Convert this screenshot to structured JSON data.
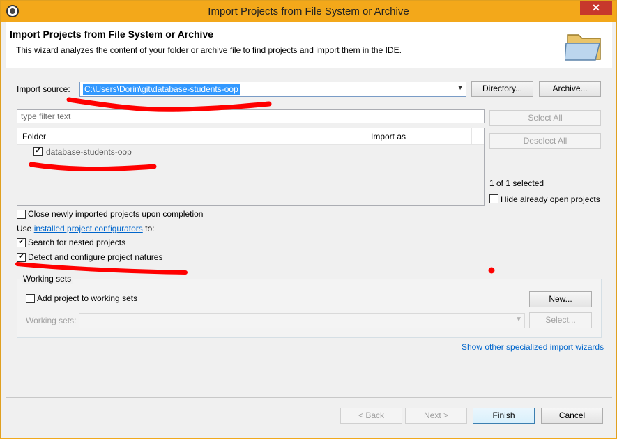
{
  "window": {
    "title": "Import Projects from File System or Archive"
  },
  "header": {
    "title": "Import Projects from File System or Archive",
    "description": "This wizard analyzes the content of your folder or archive file to find projects and import them in the IDE."
  },
  "import_source": {
    "label": "Import source:",
    "value": "C:\\Users\\Dorin\\git\\database-students-oop",
    "directory_button": "Directory...",
    "archive_button": "Archive..."
  },
  "filter": {
    "placeholder": "type filter text"
  },
  "table": {
    "columns": [
      "Folder",
      "Import as"
    ],
    "rows": [
      {
        "folder": "database-students-oop",
        "import_as": "",
        "checked": true
      }
    ]
  },
  "side": {
    "select_all": "Select All",
    "deselect_all": "Deselect All",
    "selected_count": "1 of 1 selected",
    "hide_open": "Hide already open projects"
  },
  "options": {
    "close_imported": "Close newly imported projects upon completion",
    "use_prefix": "Use ",
    "configurators_link": "installed project configurators",
    "use_suffix": " to:",
    "nested": "Search for nested projects",
    "detect": "Detect and configure project natures"
  },
  "working_sets": {
    "group_title": "Working sets",
    "add_to": "Add project to working sets",
    "new_button": "New...",
    "sets_label": "Working sets:",
    "select_button": "Select..."
  },
  "link_other": "Show other specialized import wizards",
  "footer": {
    "back": "< Back",
    "next": "Next >",
    "finish": "Finish",
    "cancel": "Cancel"
  },
  "colors": {
    "accent_titlebar": "#f3a81a",
    "selection": "#3399ff",
    "link": "#0066cc",
    "annotation_red": "#ff0000"
  }
}
